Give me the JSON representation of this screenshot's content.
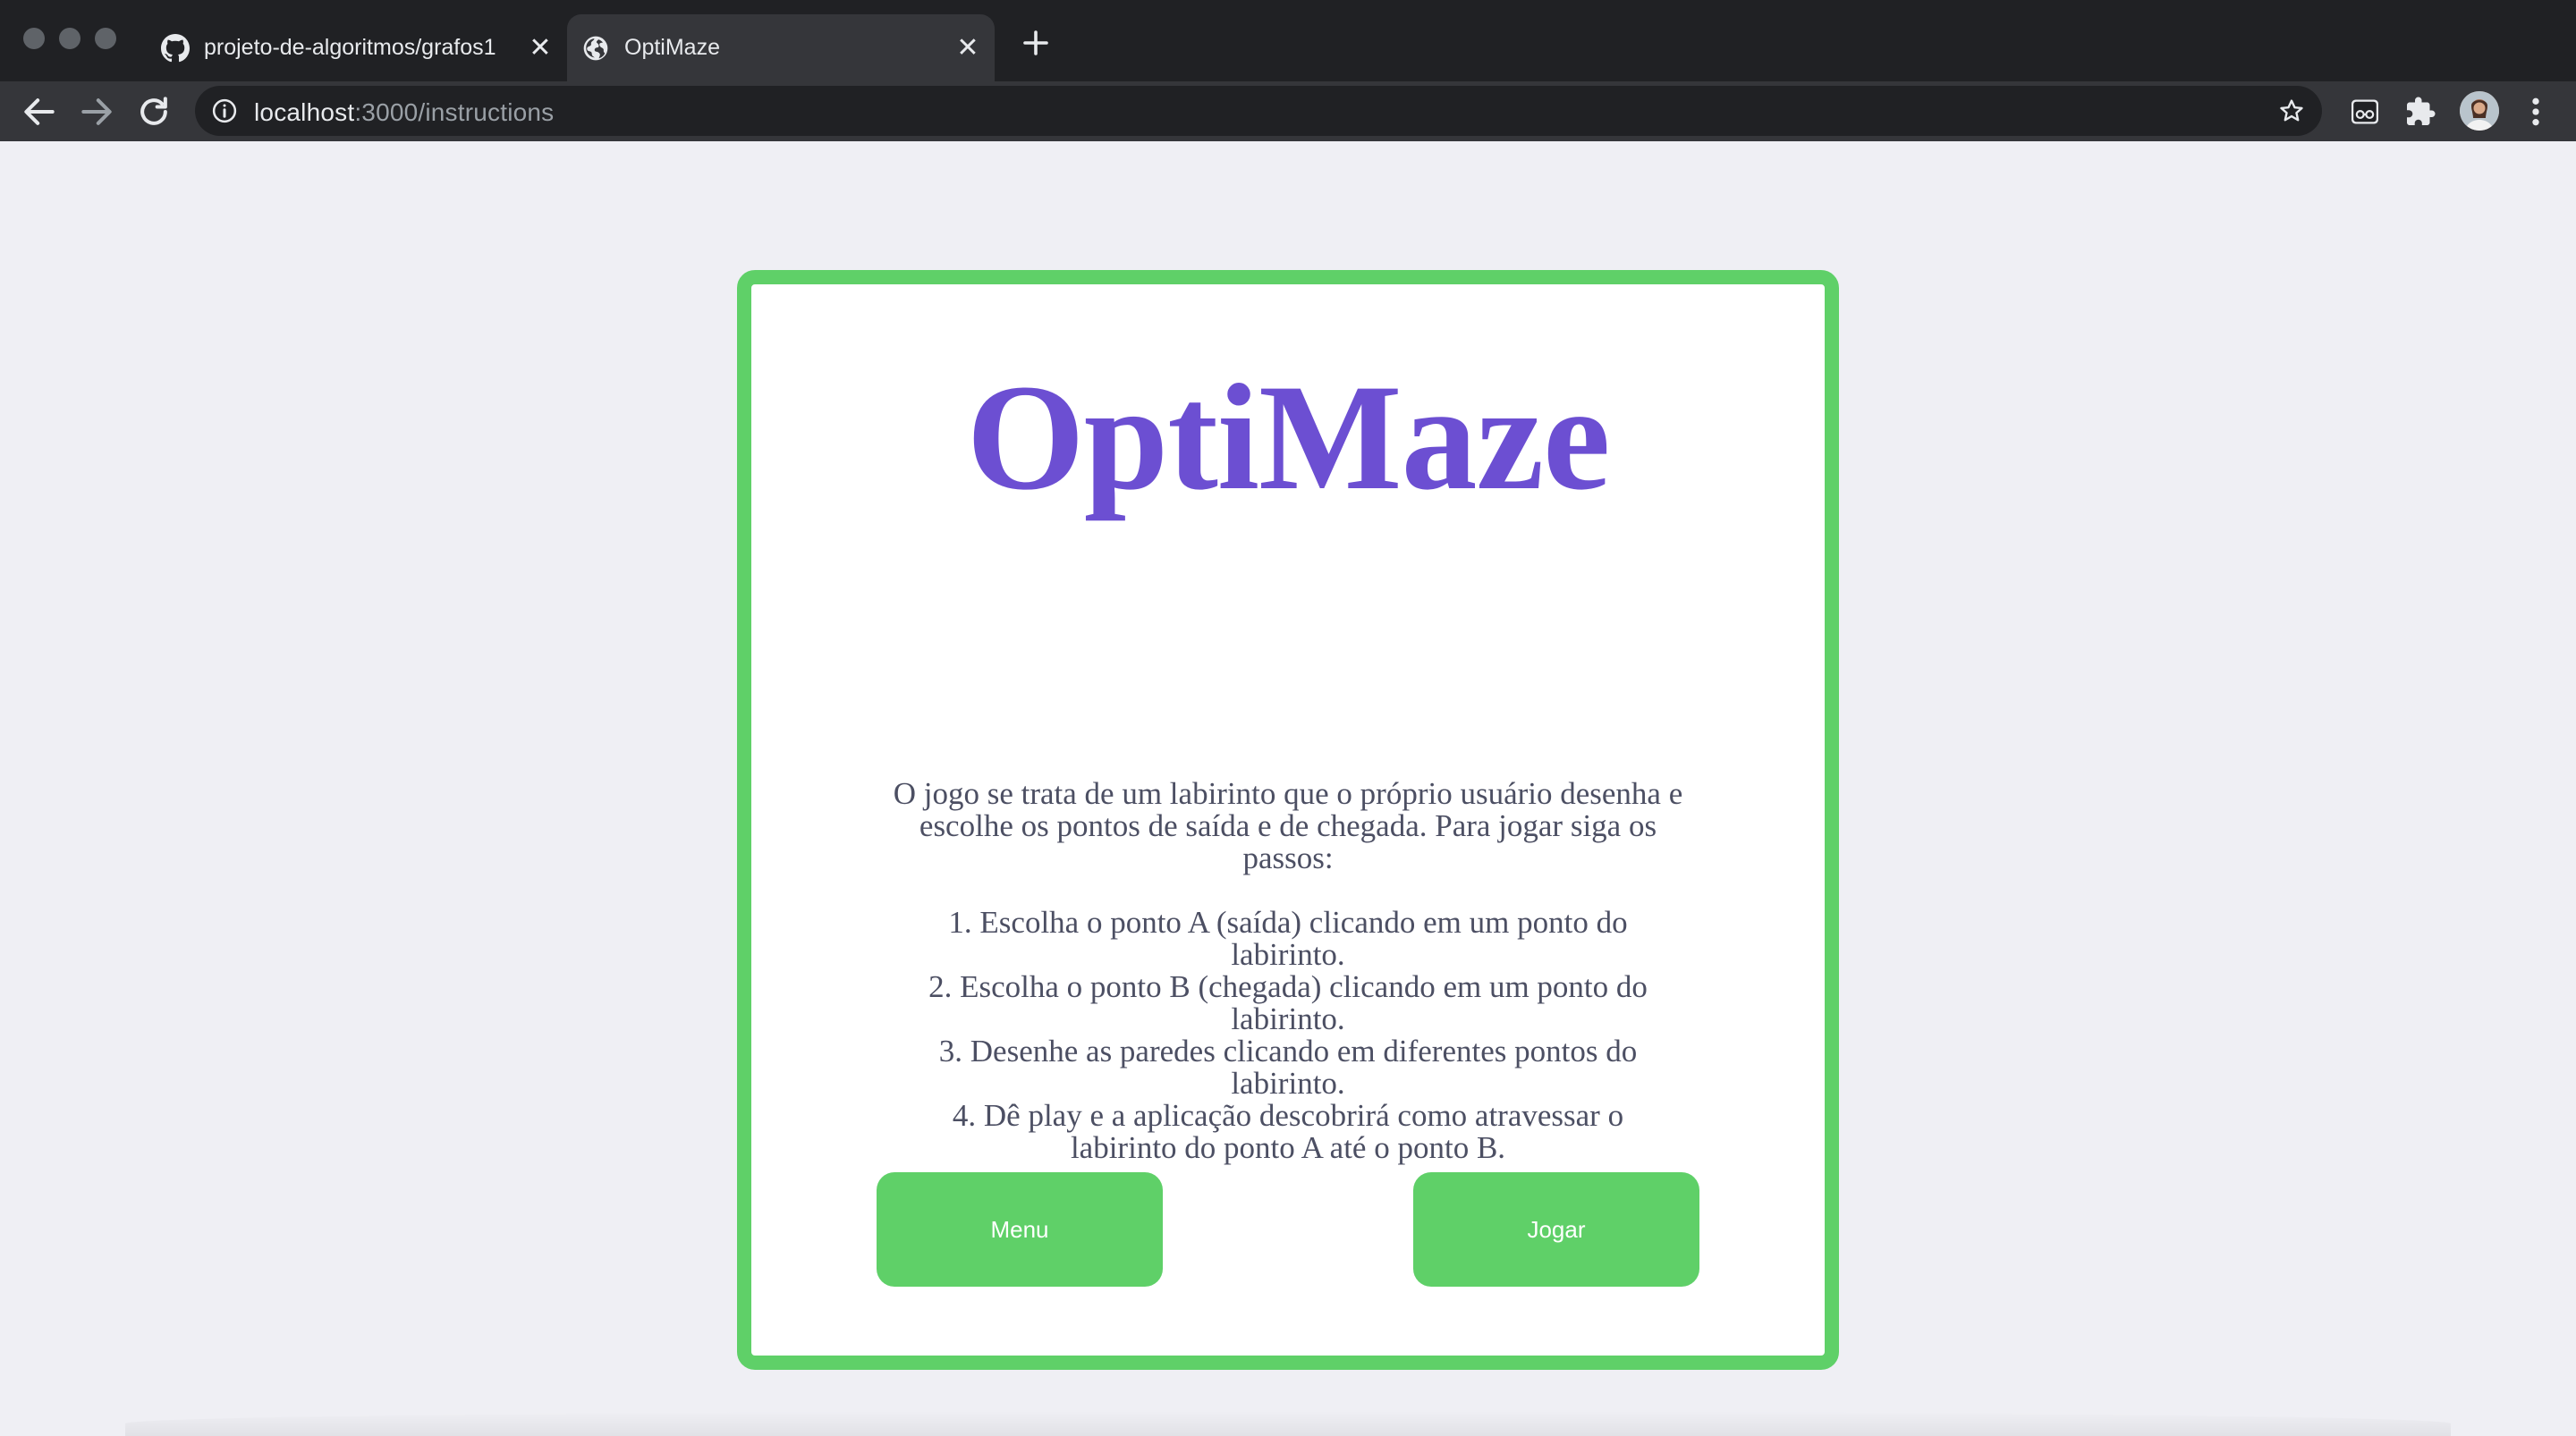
{
  "browser": {
    "tabs": [
      {
        "title": "projeto-de-algoritmos/grafos1",
        "icon": "github-icon",
        "active": false
      },
      {
        "title": "OptiMaze",
        "icon": "globe-icon",
        "active": true
      }
    ],
    "address": {
      "host": "localhost",
      "path": ":3000/instructions"
    }
  },
  "page": {
    "title": "OptiMaze",
    "description": "O jogo se trata de um labirinto que o próprio usuário desenha e escolhe os pontos de saída e de chegada. Para jogar siga os passos:",
    "steps": [
      "1. Escolha o ponto A (saída) clicando em um ponto do labirinto.",
      "2. Escolha o ponto B (chegada) clicando em um ponto do labirinto.",
      "3. Desenhe as paredes clicando em diferentes pontos do labirinto.",
      "4. Dê play e a aplicação descobrirá como atravessar o labirinto do ponto A até o ponto B."
    ],
    "buttons": {
      "menu": "Menu",
      "play": "Jogar"
    }
  },
  "colors": {
    "accent_green": "#5fd068",
    "title_purple": "#6c4fd2",
    "text": "#4c4f63",
    "page_bg": "#efeff4"
  }
}
